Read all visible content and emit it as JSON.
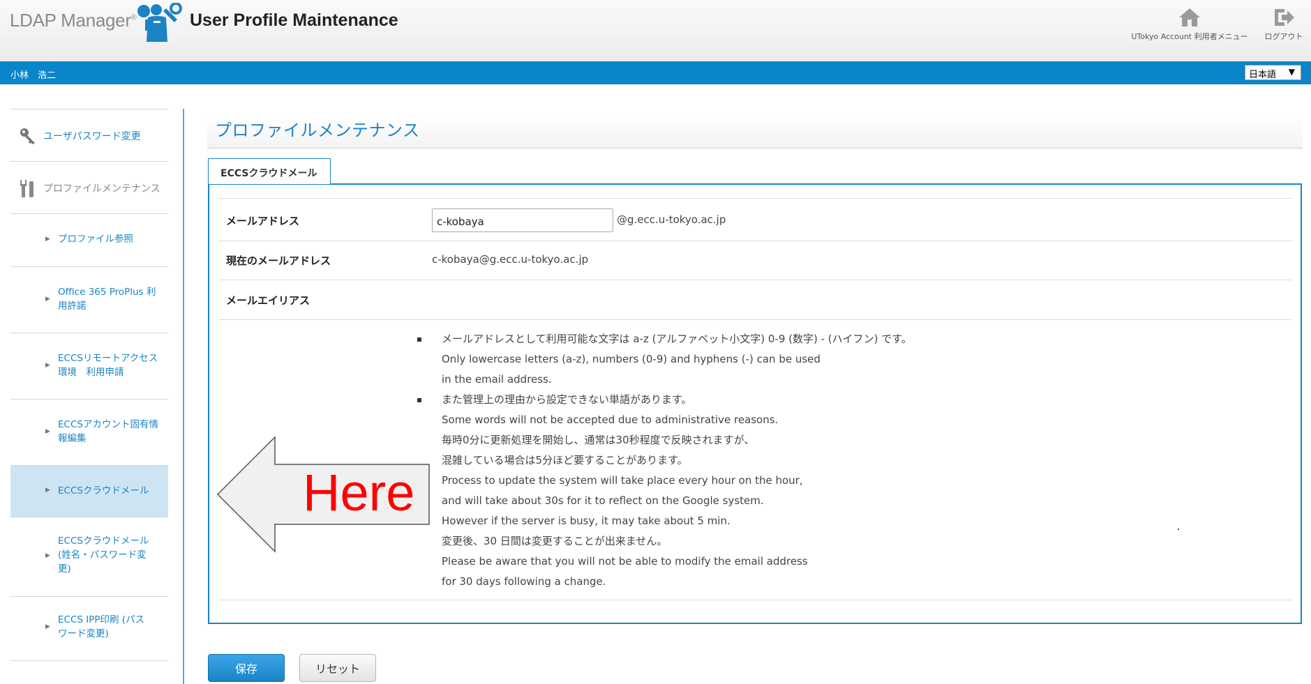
{
  "header": {
    "brand": "LDAP Manager",
    "brand_mark": "®",
    "title": "User Profile Maintenance",
    "menu_label": "UTokyo Account 利用者メニュー",
    "logout_label": "ログアウト"
  },
  "userbar": {
    "username": "小林　浩二",
    "language": "日本語"
  },
  "sidebar": {
    "items": [
      {
        "label": "ユーザパスワード変更",
        "icon": "key-icon"
      },
      {
        "label": "プロファイルメンテナンス",
        "icon": "tools-icon"
      },
      {
        "label": "プロファイル参照"
      },
      {
        "label": "Office 365 ProPlus 利用許諾"
      },
      {
        "label": "ECCSリモートアクセス環境　利用申請"
      },
      {
        "label": "ECCSアカウント固有情報編集"
      },
      {
        "label": "ECCSクラウドメール",
        "active": true
      },
      {
        "label": "ECCSクラウドメール (姓名・パスワード変更)"
      },
      {
        "label": "ECCS IPP印刷 (パスワード変更)"
      }
    ]
  },
  "main": {
    "title": "プロファイルメンテナンス",
    "tab": "ECCSクラウドメール",
    "email_label": "メールアドレス",
    "email_value": "c-kobaya",
    "email_domain": "@g.ecc.u-tokyo.ac.jp",
    "current_email_label": "現在のメールアドレス",
    "current_email_value": "c-kobaya@g.ecc.u-tokyo.ac.jp",
    "alias_label": "メールエイリアス",
    "notes": [
      "メールアドレスとして利用可能な文字は a-z (アルファベット小文字) 0-9 (数字) - (ハイフン) です。",
      "Only lowercase letters (a-z), numbers (0-9) and hyphens (-) can be used",
      "in the email address.",
      "また管理上の理由から設定できない単語があります。",
      "Some words will not be accepted due to administrative reasons.",
      "毎時0分に更新処理を開始し、通常は30秒程度で反映されますが、",
      "混雑している場合は5分ほど要することがあります。",
      "Process to update the system will take place every hour on the hour,",
      "and will take about 30s for it to reflect on the Google system.",
      "However if the server is busy, it may take about 5 min.",
      "変更後、30 日間は変更することが出来ません。",
      "Please be aware that you will not be able to modify the email address",
      "for 30 days following a change."
    ],
    "annotation": "Here",
    "save_label": "保存",
    "reset_label": "リセット"
  },
  "colors": {
    "accent": "#1a84c6",
    "bar": "#0b85c9",
    "active_bg": "#cde5f3",
    "annotation": "#ff0000"
  }
}
